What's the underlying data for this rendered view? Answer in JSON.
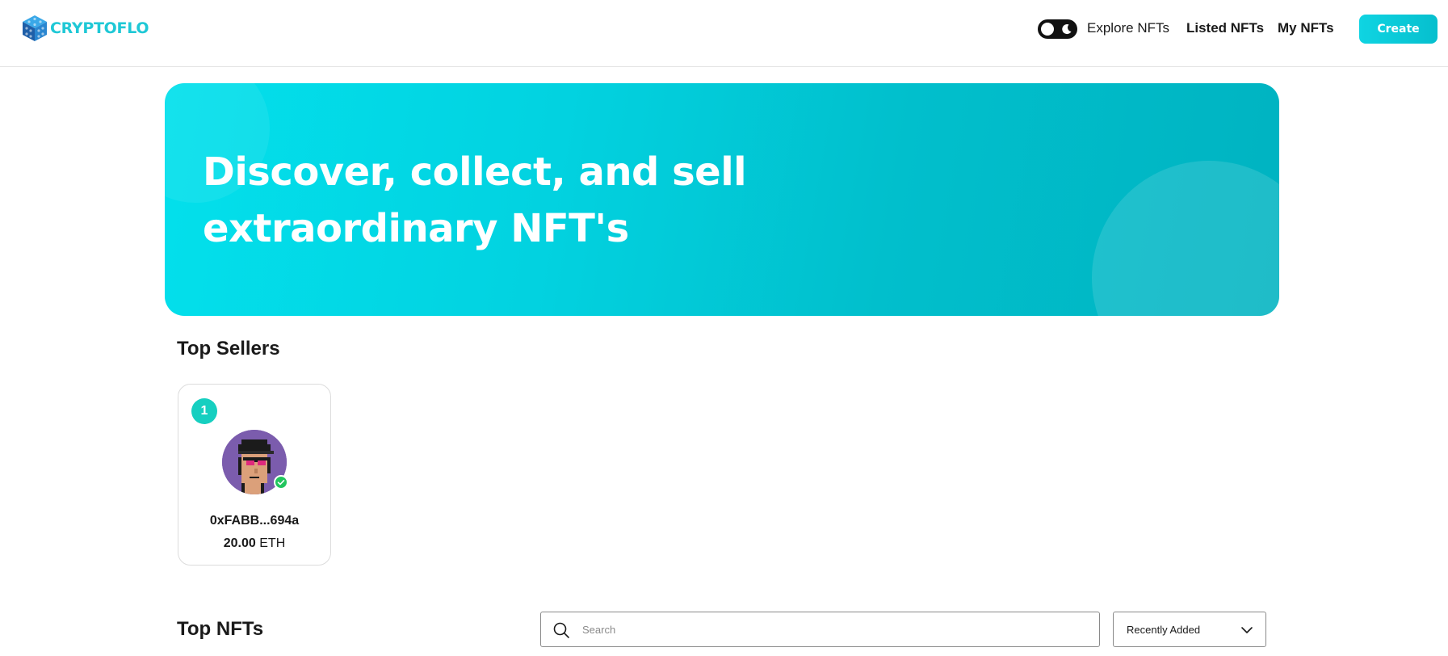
{
  "header": {
    "logo_text": "CRYPTOFLO",
    "theme_toggle_icon": "moon-icon",
    "nav": [
      {
        "label": "Explore NFTs"
      },
      {
        "label": "Listed NFTs"
      },
      {
        "label": "My NFTs"
      }
    ],
    "create_label": "Create"
  },
  "hero": {
    "title": "Discover, collect, and sell extraordinary NFT's"
  },
  "top_sellers": {
    "title": "Top Sellers",
    "sellers": [
      {
        "rank": "1",
        "address": "0xFABB...694a",
        "amount": "20.00",
        "currency": "ETH",
        "verified": true
      }
    ]
  },
  "top_nfts": {
    "title": "Top NFTs",
    "search_placeholder": "Search",
    "sort_selected": "Recently Added"
  },
  "colors": {
    "brand": "#1fc8d6",
    "hero_start": "#03e0ec",
    "hero_end": "#00b3c1",
    "rank_badge": "#16cfc0",
    "verified": "#22c55e",
    "avatar_bg": "#7b5cad"
  }
}
